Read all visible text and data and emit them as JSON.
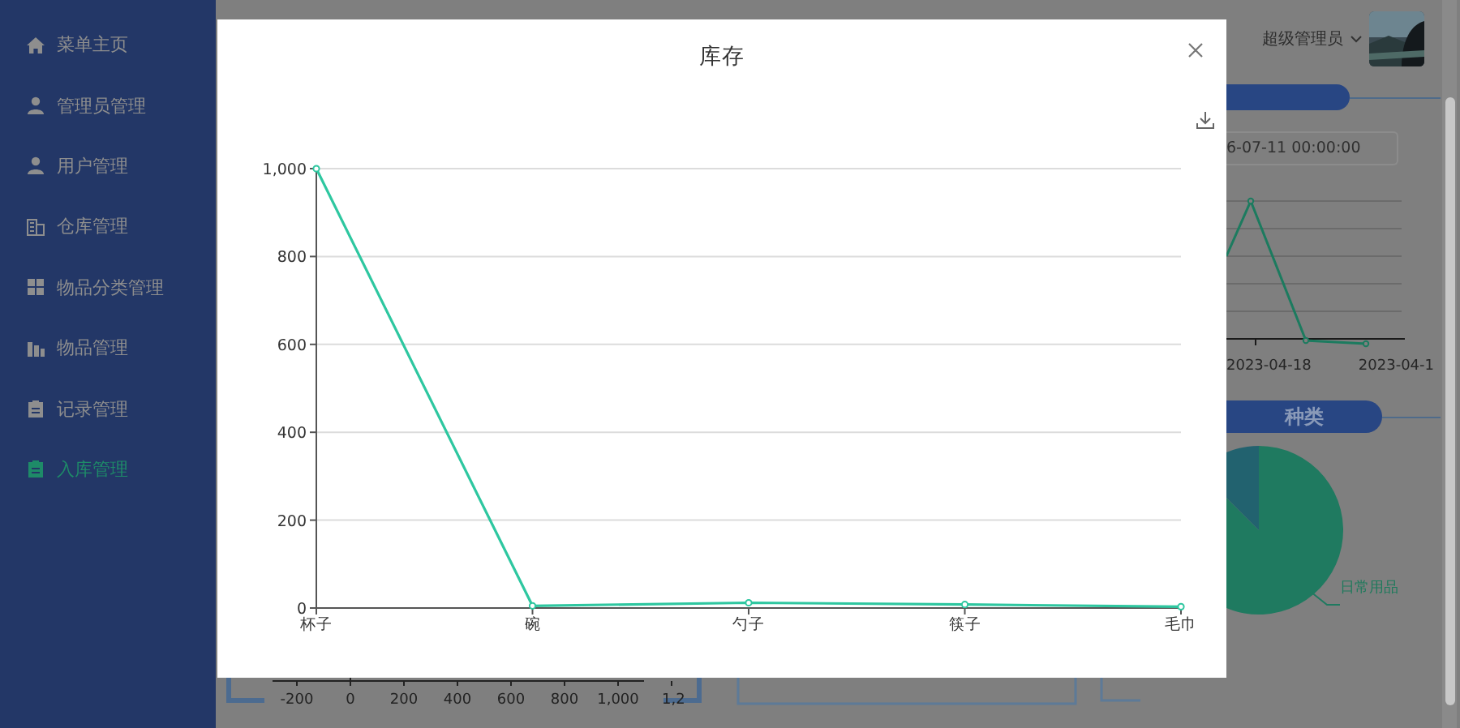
{
  "sidebar": {
    "items": [
      {
        "label": "菜单主页",
        "kind": "home",
        "selected": false
      },
      {
        "label": "管理员管理",
        "kind": "person",
        "selected": false
      },
      {
        "label": "用户管理",
        "kind": "person",
        "selected": false
      },
      {
        "label": "仓库管理",
        "kind": "building",
        "selected": false
      },
      {
        "label": "物品分类管理",
        "kind": "grid",
        "selected": false
      },
      {
        "label": "物品管理",
        "kind": "bars",
        "selected": false
      },
      {
        "label": "记录管理",
        "kind": "clipboard",
        "selected": false
      },
      {
        "label": "入库管理",
        "kind": "clipboard",
        "selected": true
      }
    ]
  },
  "header": {
    "user": "超级管理员"
  },
  "right_panel": {
    "date_field": "6-07-11 00:00:00",
    "line_chart_labels": [
      "2023-04-18",
      "2023-04-1"
    ],
    "section_title": "种类",
    "pie_label": "日常用品"
  },
  "bottom_chart": {
    "ticks": [
      "-200",
      "0",
      "200",
      "400",
      "600",
      "800",
      "1,000",
      "1,2"
    ]
  },
  "modal": {
    "title": "库存",
    "chart_data": {
      "type": "line",
      "categories": [
        "杯子",
        "碗",
        "勺子",
        "筷子",
        "毛巾"
      ],
      "grid": true,
      "series": [
        {
          "color": "#2ec7a0",
          "marker": true,
          "values": [
            1000,
            5,
            12,
            8,
            3
          ]
        }
      ],
      "ylim": [
        0,
        1000
      ],
      "yticks": [
        0,
        200,
        400,
        600,
        800,
        {
          "value": 1000,
          "label": "1,000"
        }
      ]
    }
  }
}
